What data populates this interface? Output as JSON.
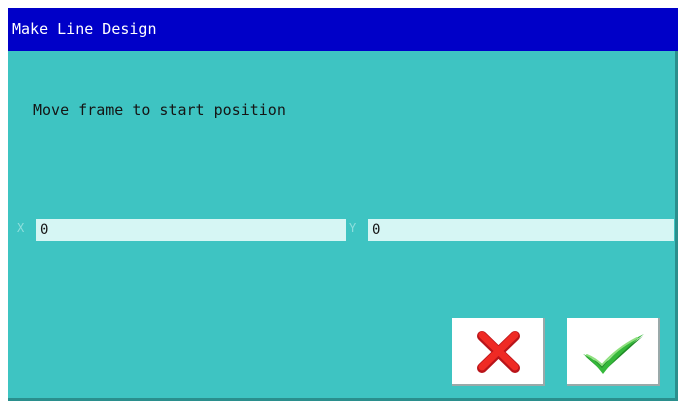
{
  "window": {
    "title": "Make Line Design"
  },
  "main": {
    "message": "Move frame to start position",
    "x": {
      "label": "X",
      "value": "0"
    },
    "y": {
      "label": "Y",
      "value": "0"
    }
  },
  "buttons": {
    "cancel": {
      "icon": "red-x-icon"
    },
    "confirm": {
      "icon": "green-checkmark-icon"
    }
  },
  "colors": {
    "titlebar": "#0000c8",
    "dialog_background": "#3ec4c2",
    "field_background": "#d6f6f4",
    "cancel_icon": "#e0201c",
    "confirm_icon": "#2fa82f"
  }
}
